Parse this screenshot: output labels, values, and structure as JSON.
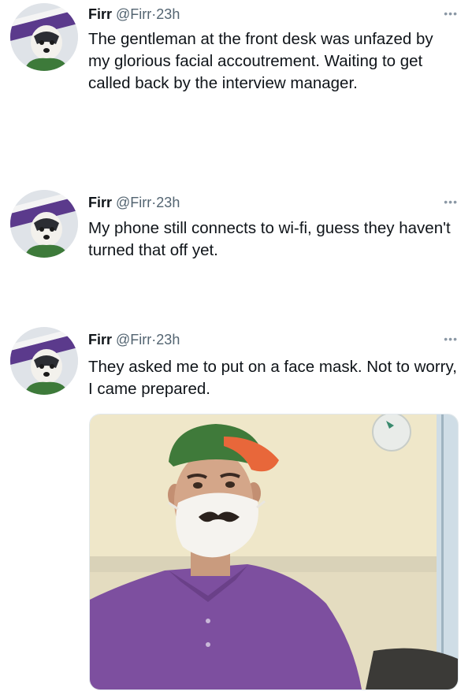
{
  "tweets": [
    {
      "name": "Firr",
      "handle": "@Firr",
      "separator": "·",
      "time": "23h",
      "more_icon": "more-dots-icon",
      "text": "The gentleman at the front desk was unfazed by my glorious facial accoutrement. Waiting to get called back by the interview manager."
    },
    {
      "name": "Firr",
      "handle": "@Firr",
      "separator": "·",
      "time": "23h",
      "more_icon": "more-dots-icon",
      "text": "My phone still connects to wi-fi, guess they haven't turned that off yet."
    },
    {
      "name": "Firr",
      "handle": "@Firr",
      "separator": "·",
      "time": "23h",
      "more_icon": "more-dots-icon",
      "text": "They asked me to put on a face mask. Not to worry, I came prepared."
    }
  ],
  "colors": {
    "text": "#0f1419",
    "secondary": "#536471",
    "shirt": "#7d4f9f",
    "cap": "#3f7a3a",
    "wall": "#efe7c9"
  }
}
